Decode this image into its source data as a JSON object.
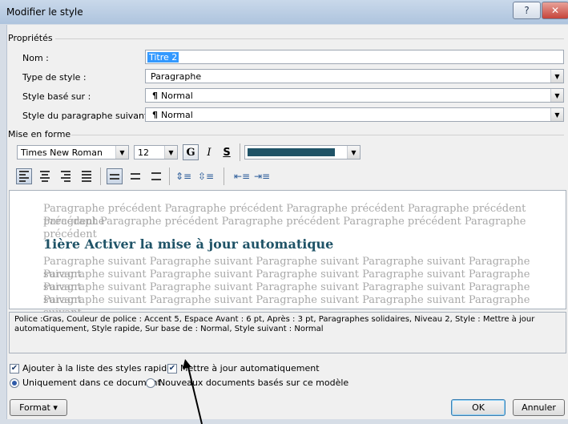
{
  "window": {
    "title": "Modifier le style",
    "help": "?",
    "close": "✕"
  },
  "proprietes": {
    "group_label": "Propriétés",
    "nom_label": "Nom :",
    "nom_value": "Titre 2",
    "type_label": "Type de style :",
    "type_value": "Paragraphe",
    "base_label": "Style basé sur :",
    "base_value": "Normal",
    "suivant_label": "Style du paragraphe suivant :",
    "suivant_value": "Normal"
  },
  "mise_en_forme": {
    "group_label": "Mise en forme",
    "font": "Times New Roman",
    "size": "12",
    "bold": "G",
    "italic": "I",
    "underline": "S",
    "color": "#1f5367"
  },
  "preview": {
    "prev_line1": "Paragraphe précédent Paragraphe précédent Paragraphe précédent Paragraphe précédent Paragraphe",
    "prev_line2": "précédent Paragraphe précédent Paragraphe précédent Paragraphe précédent Paragraphe précédent",
    "heading": "1ière Activer la mise à jour automatique",
    "next_line1": "Paragraphe suivant Paragraphe suivant Paragraphe suivant Paragraphe suivant Paragraphe suivant",
    "next_line2": "Paragraphe suivant Paragraphe suivant Paragraphe suivant Paragraphe suivant Paragraphe suivant",
    "next_line3": "Paragraphe suivant Paragraphe suivant Paragraphe suivant Paragraphe suivant Paragraphe suivant",
    "next_line4": "Paragraphe suivant Paragraphe suivant Paragraphe suivant Paragraphe suivant Paragraphe suivant"
  },
  "description": "Police :Gras, Couleur de police : Accent 5, Espace Avant : 6 pt, Après : 3 pt, Paragraphes solidaires, Niveau 2, Style : Mettre à jour automatiquement, Style rapide, Sur base de : Normal, Style suivant : Normal",
  "options": {
    "add_quick": "Ajouter à la liste des styles rapides",
    "auto_update": "Mettre à jour automatiquement",
    "only_doc": "Uniquement dans ce document",
    "new_docs": "Nouveaux documents basés sur ce modèle"
  },
  "buttons": {
    "format": "Format ▾",
    "ok": "OK",
    "cancel": "Annuler"
  }
}
